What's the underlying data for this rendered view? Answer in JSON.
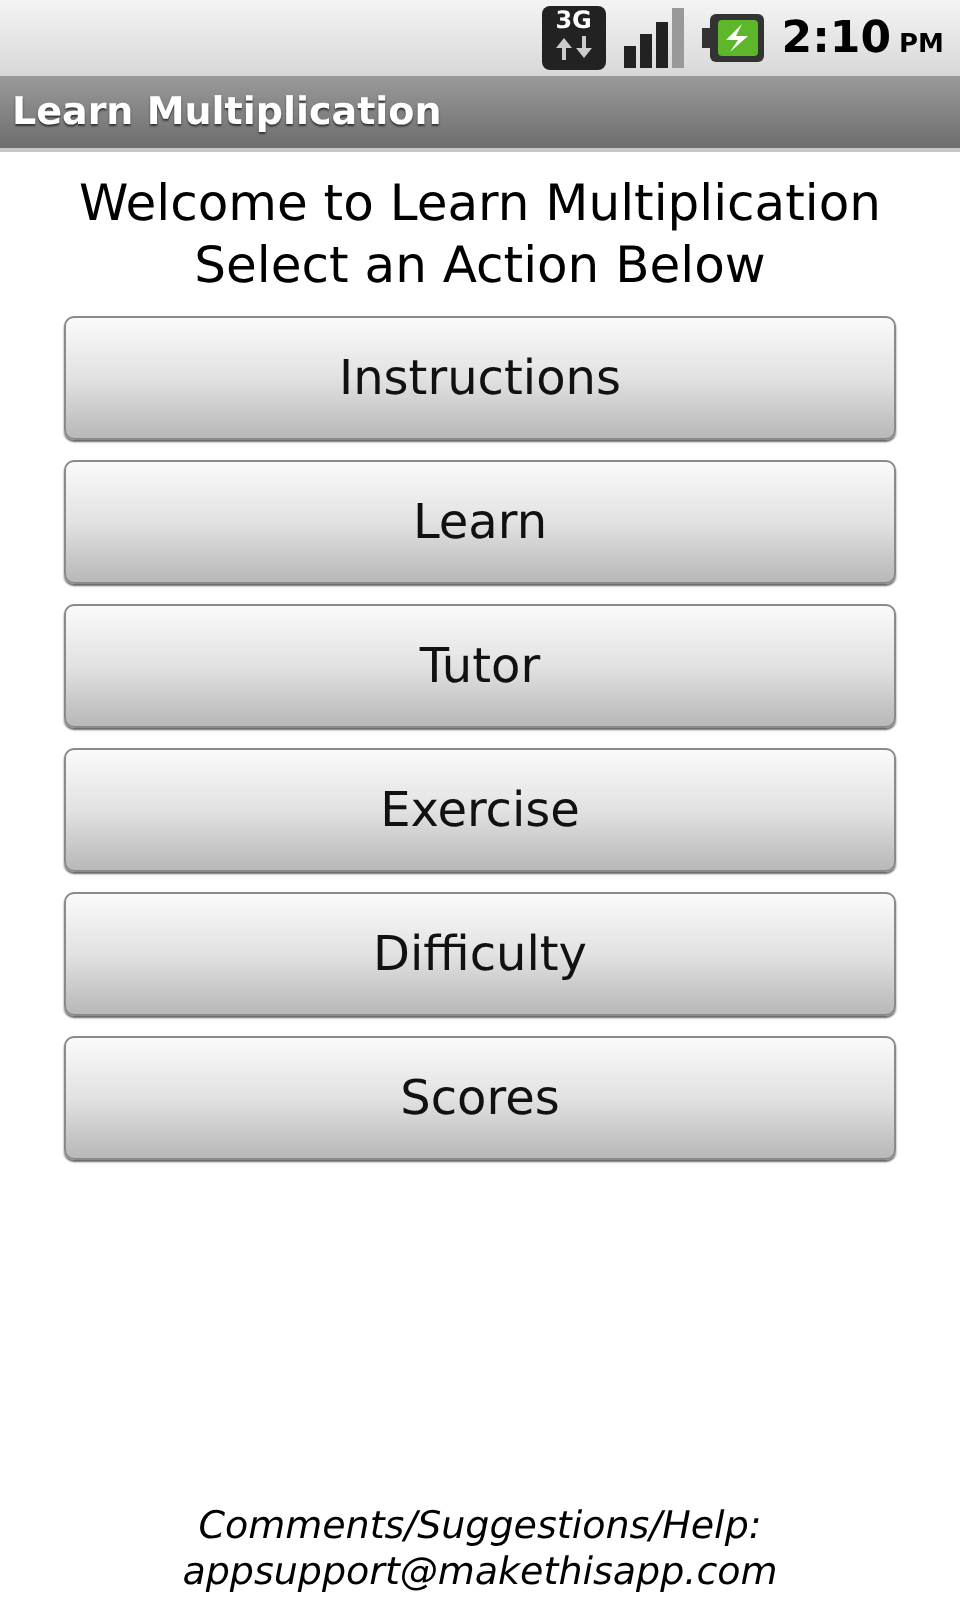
{
  "status_bar": {
    "network": "3G",
    "time": "2:10",
    "meridiem": "PM"
  },
  "title_bar": {
    "title": "Learn Multiplication"
  },
  "heading": [
    "Welcome to Learn Multiplication",
    "Select an Action Below"
  ],
  "buttons": [
    "Instructions",
    "Learn",
    "Tutor",
    "Exercise",
    "Difficulty",
    "Scores"
  ],
  "footer": [
    "Comments/Suggestions/Help:",
    "appsupport@makethisapp.com"
  ]
}
